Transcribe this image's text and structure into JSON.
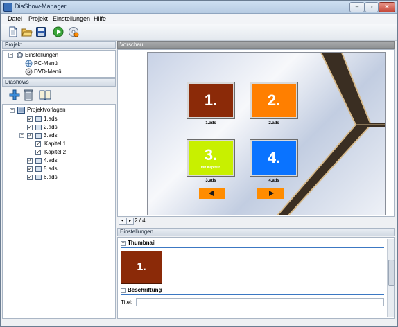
{
  "window": {
    "title": "DiaShow-Manager"
  },
  "menu": [
    "Datei",
    "Projekt",
    "Einstellungen",
    "Hilfe"
  ],
  "project_panel": {
    "header": "Projekt",
    "items": [
      {
        "label": "Einstellungen"
      },
      {
        "label": "PC-Menü"
      },
      {
        "label": "DVD-Menü"
      }
    ]
  },
  "diashows_panel": {
    "header": "Diashows",
    "root": "Projektvorlagen",
    "items": [
      {
        "label": "1.ads",
        "checked": true
      },
      {
        "label": "2.ads",
        "checked": true
      },
      {
        "label": "3.ads",
        "checked": true
      },
      {
        "label": "Kapitel 1",
        "checked": true
      },
      {
        "label": "Kapitel 2",
        "checked": true
      },
      {
        "label": "4.ads",
        "checked": true
      },
      {
        "label": "5.ads",
        "checked": true
      },
      {
        "label": "6.ads",
        "checked": true
      }
    ]
  },
  "preview": {
    "header": "Vorschau",
    "tiles": [
      {
        "number": "1.",
        "caption": "1.ads",
        "color": "#8b2a08"
      },
      {
        "number": "2.",
        "caption": "2.ads",
        "color": "#ff7f00"
      },
      {
        "number": "3.",
        "caption": "3.ads",
        "color": "#c8f000",
        "subtitle": "mit Kapiteln"
      },
      {
        "number": "4.",
        "caption": "4.ads",
        "color": "#0a73ff"
      }
    ],
    "page_indicator": "2 / 4"
  },
  "settings": {
    "header": "Einstellungen",
    "section_thumbnail": "Thumbnail",
    "thumbnail_number": "1.",
    "section_caption": "Beschriftung",
    "title_label": "Titel:",
    "title_value": ""
  }
}
